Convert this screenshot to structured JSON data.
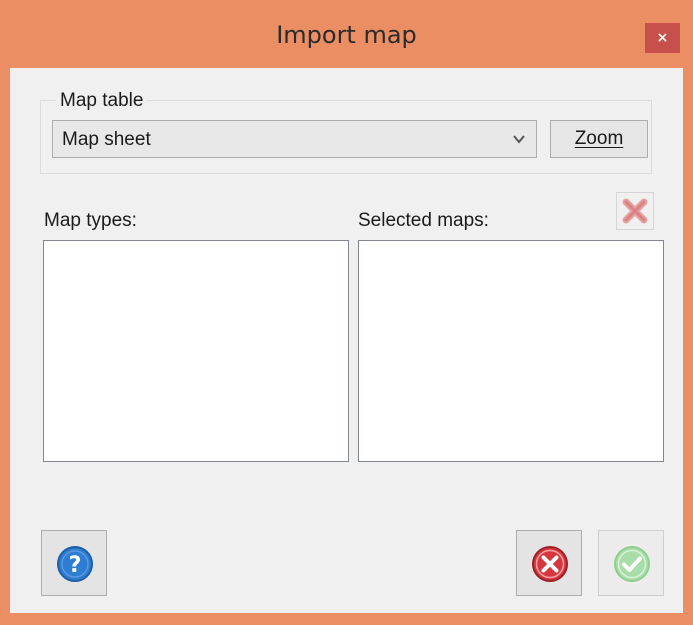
{
  "window": {
    "title": "Import map",
    "close_label": "×"
  },
  "map_table": {
    "group_label": "Map table",
    "selected_value": "Map sheet",
    "zoom_label": "Zoom"
  },
  "map_types": {
    "label": "Map types:",
    "items": []
  },
  "selected_maps": {
    "label": "Selected maps:",
    "items": []
  },
  "icons": {
    "dropdown": "chevron-down-icon",
    "remove": "remove-x-icon",
    "help": "help-icon",
    "cancel": "cancel-icon",
    "ok": "ok-check-icon"
  },
  "colors": {
    "titlebar": "#ec8e63",
    "close_button": "#c7504a",
    "dialog_background": "#f0f0f0",
    "help_blue": "#2f7dd2",
    "cancel_red": "#d6373f",
    "ok_green": "#8fcf8f"
  },
  "ok_button": {
    "enabled": false
  }
}
